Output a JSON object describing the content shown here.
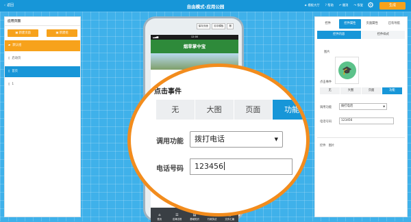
{
  "topbar": {
    "back_label": "返回",
    "title": "自由模式-应用公园",
    "links": [
      "模板大厅",
      "帮助",
      "撤消",
      "恢复"
    ],
    "generate_label": "生成"
  },
  "left_panel": {
    "title": "应用页面",
    "new_page_label": "新建页面",
    "new_group_label": "新建组",
    "items": [
      {
        "label": "默认组",
        "style": "orange"
      },
      {
        "label": "启动页",
        "style": "plain"
      },
      {
        "label": "首页",
        "style": "blue"
      },
      {
        "label": "1",
        "style": "plain"
      }
    ]
  },
  "phone": {
    "toolbar": [
      "保存页面",
      "另存模板",
      "撤"
    ],
    "time": "12:00",
    "banner_title": "烟草掌中宝",
    "tabs": [
      "首页",
      "法律法规",
      "基础知识",
      "行政执法",
      "文件汇编"
    ]
  },
  "right_panel": {
    "tabs": [
      "控件",
      "控件属性",
      "页面属性",
      "已有导航"
    ],
    "subtabs": [
      "控件内容",
      "控件样式"
    ],
    "image_label": "图片",
    "click_event_label": "点击事件",
    "event_options": [
      "无",
      "大图",
      "页面",
      "功能"
    ],
    "call_function_label": "调用功能",
    "call_function_value": "拨打电话",
    "phone_label": "电话号码",
    "phone_value": "123456",
    "bottom_labels": [
      "控件",
      "图片"
    ]
  },
  "magnifier": {
    "click_event_label": "点击事件",
    "event_options": [
      "无",
      "大图",
      "页面",
      "功能"
    ],
    "active_option": "功能",
    "call_function_label": "调用功能",
    "call_function_value": "拨打电话",
    "phone_label": "电话号码",
    "phone_value": "123456"
  },
  "colors": {
    "accent_blue": "#1796d8",
    "accent_orange": "#f7a21b",
    "magnifier_border": "#f28c1d",
    "canvas_bg": "#3fb1ea"
  }
}
